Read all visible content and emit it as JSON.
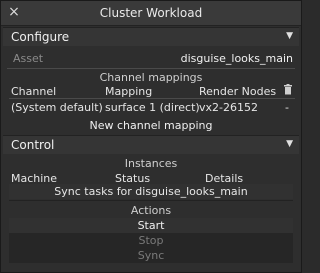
{
  "window": {
    "title": "Cluster Workload",
    "close_glyph": "×"
  },
  "configure": {
    "header": "Configure",
    "asset_label": "Asset",
    "asset_value": "disguise_looks_main",
    "mappings_title": "Channel mappings",
    "columns": [
      "Channel",
      "Mapping",
      "Render Nodes"
    ],
    "row": {
      "channel": "(System default)",
      "mapping": "surface 1 (direct)",
      "render_nodes": "vx2-26152",
      "extra": "-"
    },
    "new_mapping": "New channel mapping"
  },
  "control": {
    "header": "Control",
    "instances_title": "Instances",
    "columns": [
      "Machine",
      "Status",
      "Details"
    ],
    "sync_tasks": "Sync tasks for disguise_looks_main",
    "actions_title": "Actions",
    "start": "Start",
    "stop": "Stop",
    "sync": "Sync"
  }
}
